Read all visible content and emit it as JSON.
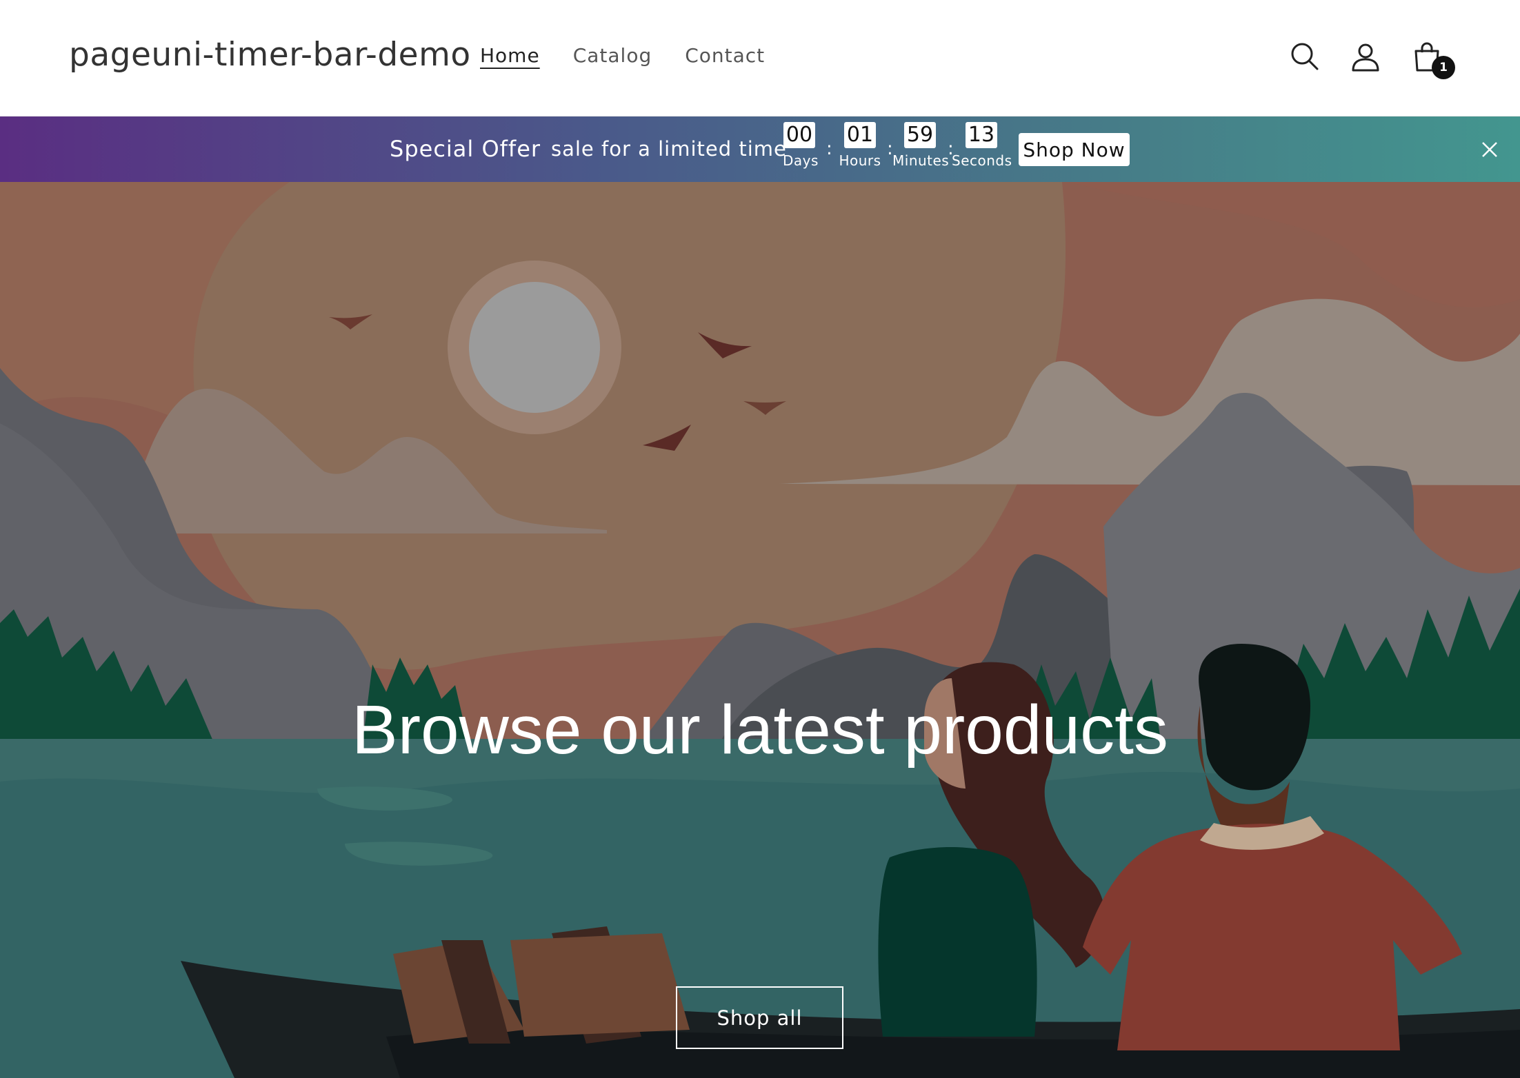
{
  "header": {
    "logo": "pageuni-timer-bar-demo",
    "nav": [
      {
        "label": "Home",
        "active": true
      },
      {
        "label": "Catalog",
        "active": false
      },
      {
        "label": "Contact",
        "active": false
      }
    ],
    "icons": [
      "search-icon",
      "account-icon",
      "cart-icon"
    ],
    "cart_count": "1"
  },
  "timer_bar": {
    "title": "Special Offer",
    "subtitle": "sale for a limited time",
    "countdown": [
      {
        "value": "00",
        "label": "Days"
      },
      {
        "value": "01",
        "label": "Hours"
      },
      {
        "value": "59",
        "label": "Minutes"
      },
      {
        "value": "13",
        "label": "Seconds"
      }
    ],
    "separator": ":",
    "button_label": "Shop Now",
    "close_icon": "close-icon",
    "gradient_start": "#5a2e82",
    "gradient_end": "#43968f"
  },
  "hero": {
    "title": "Browse our latest products",
    "button_label": "Shop all"
  }
}
